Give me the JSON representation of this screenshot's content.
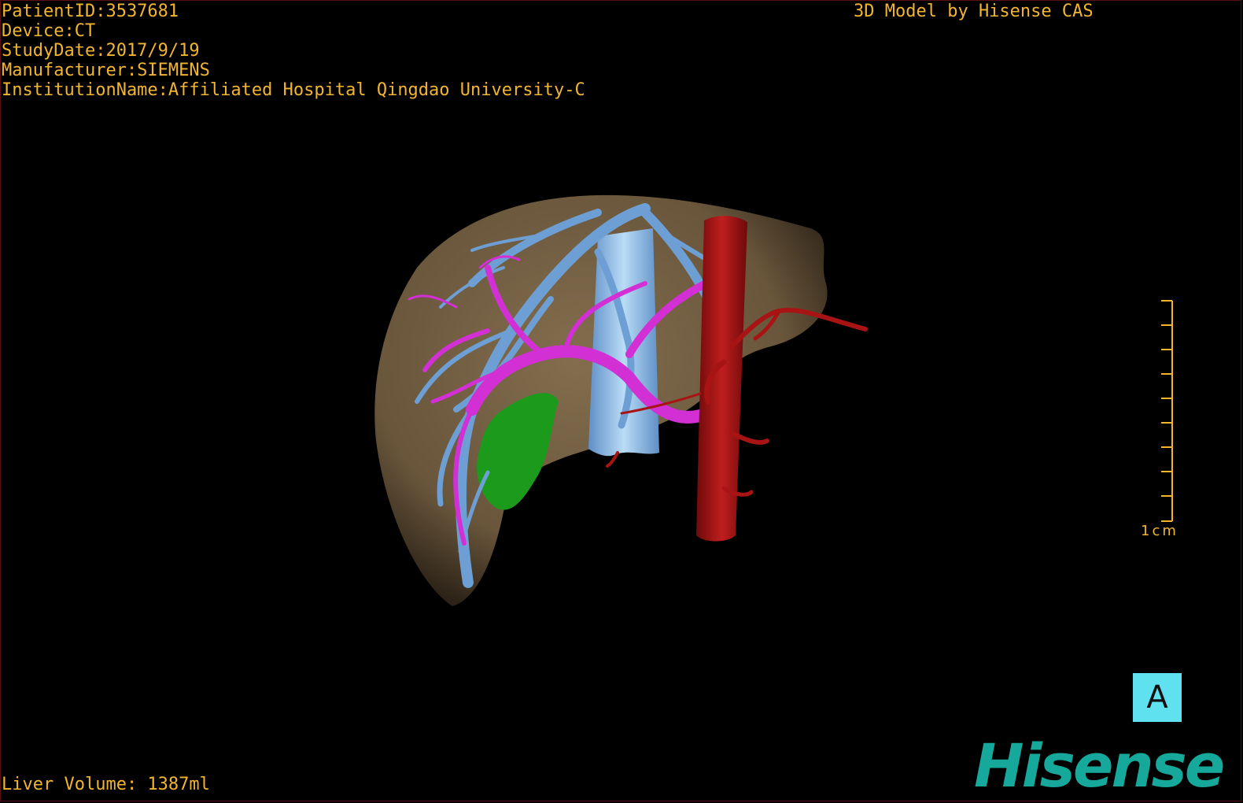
{
  "overlay": {
    "patient_id": "PatientID:3537681",
    "device": "Device:CT",
    "study_date": "StudyDate:2017/9/19",
    "manufacturer": "Manufacturer:SIEMENS",
    "institution": "InstitutionName:Affiliated Hospital Qingdao University-C",
    "model_credit": "3D Model by Hisense CAS",
    "liver_volume": "Liver Volume: 1387ml"
  },
  "scale_bar": {
    "label": "1cm"
  },
  "orientation": {
    "label": "A"
  },
  "logo": {
    "text": "Hisense"
  },
  "colors": {
    "overlay_text": "#f2b530",
    "liver": "#7a6548",
    "hepatic_vein": "#6e9fd4",
    "portal_vein": "#d22fd4",
    "artery": "#a81414",
    "lesion": "#1c9a1c",
    "ivc": "#8fc4ee",
    "orientation_box": "#5fe1f0",
    "logo": "#16a89a"
  }
}
